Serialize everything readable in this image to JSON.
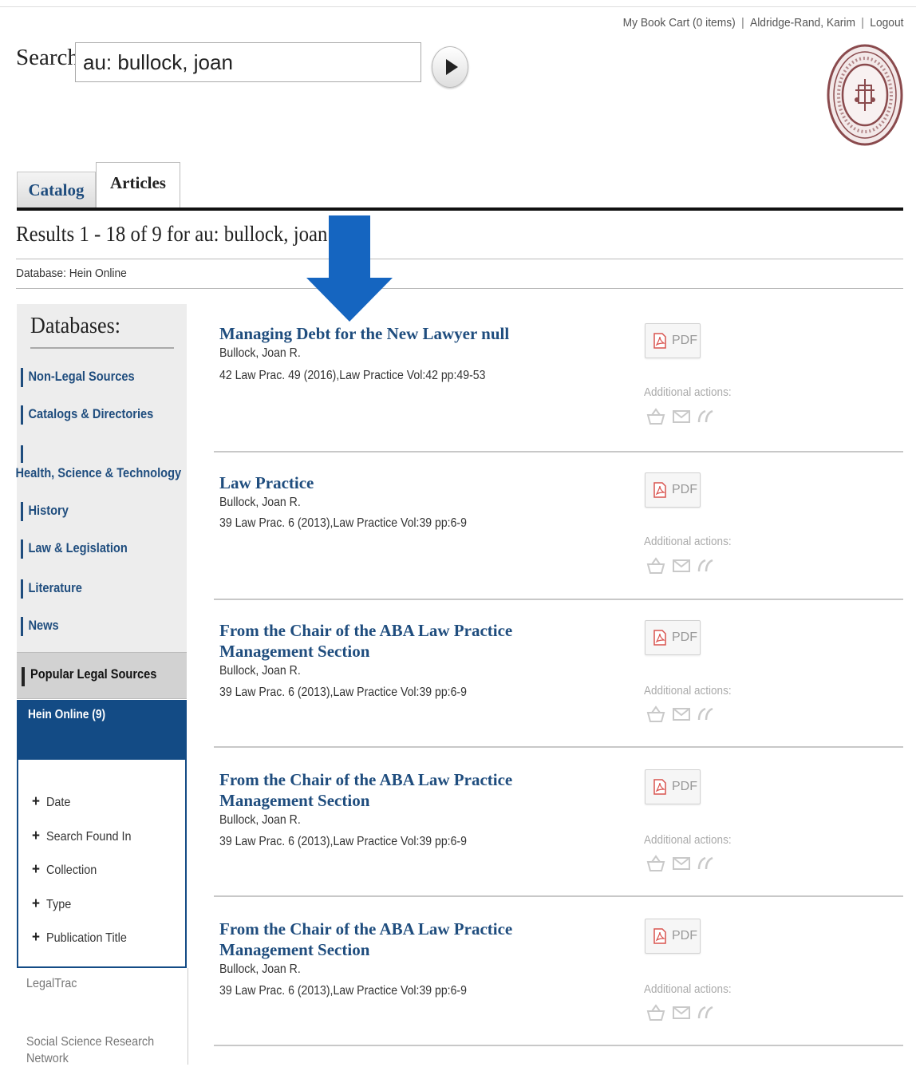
{
  "header": {
    "book_cart": "My Book Cart (0 items)",
    "user": "Aldridge-Rand, Karim",
    "logout": "Logout",
    "separator": "|"
  },
  "search": {
    "label": "Search",
    "query": "au: bullock, joan"
  },
  "tabs": {
    "catalog": "Catalog",
    "articles": "Articles"
  },
  "results_heading": "Results 1 - 18 of 9 for au: bullock, joan",
  "database_line": "Database: Hein Online",
  "sidebar": {
    "title": "Databases:",
    "items": [
      "Non-Legal Sources",
      "Catalogs & Directories",
      "Health, Science & Technology",
      "History",
      "Law & Legislation",
      "Literature",
      "News"
    ],
    "popular": "Popular Legal Sources",
    "selected_db": "Hein Online (9)",
    "facets": [
      "Date",
      "Search Found In",
      "Collection",
      "Type",
      "Publication Title"
    ],
    "other_dbs": [
      "LegalTrac",
      "Social Science Research Network"
    ]
  },
  "results": [
    {
      "title": "Managing Debt for the New Lawyer null",
      "author": "Bullock, Joan R.",
      "citation": "42 Law Prac. 49 (2016),Law Practice Vol:42 pp:49-53"
    },
    {
      "title": "Law Practice",
      "author": "Bullock, Joan R.",
      "citation": "39 Law Prac. 6 (2013),Law Practice Vol:39 pp:6-9"
    },
    {
      "title": "From the Chair of the ABA Law Practice Management Section",
      "author": "Bullock, Joan R.",
      "citation": "39 Law Prac. 6 (2013),Law Practice Vol:39 pp:6-9"
    },
    {
      "title": "From the Chair of the ABA Law Practice Management Section",
      "author": "Bullock, Joan R.",
      "citation": "39 Law Prac. 6 (2013),Law Practice Vol:39 pp:6-9"
    },
    {
      "title": "From the Chair of the ABA Law Practice Management Section",
      "author": "Bullock, Joan R.",
      "citation": "39 Law Prac. 6 (2013),Law Practice Vol:39 pp:6-9"
    }
  ],
  "result_actions": {
    "pdf_label": "PDF",
    "additional_actions": "Additional actions:",
    "icons": [
      "basket-icon",
      "mail-icon",
      "cite-icon"
    ]
  },
  "colors": {
    "link_blue": "#1f4d7e",
    "selected_db_bg": "#134b85",
    "arrow_blue": "#1565c0",
    "seal_maroon": "#8a4a4d"
  }
}
